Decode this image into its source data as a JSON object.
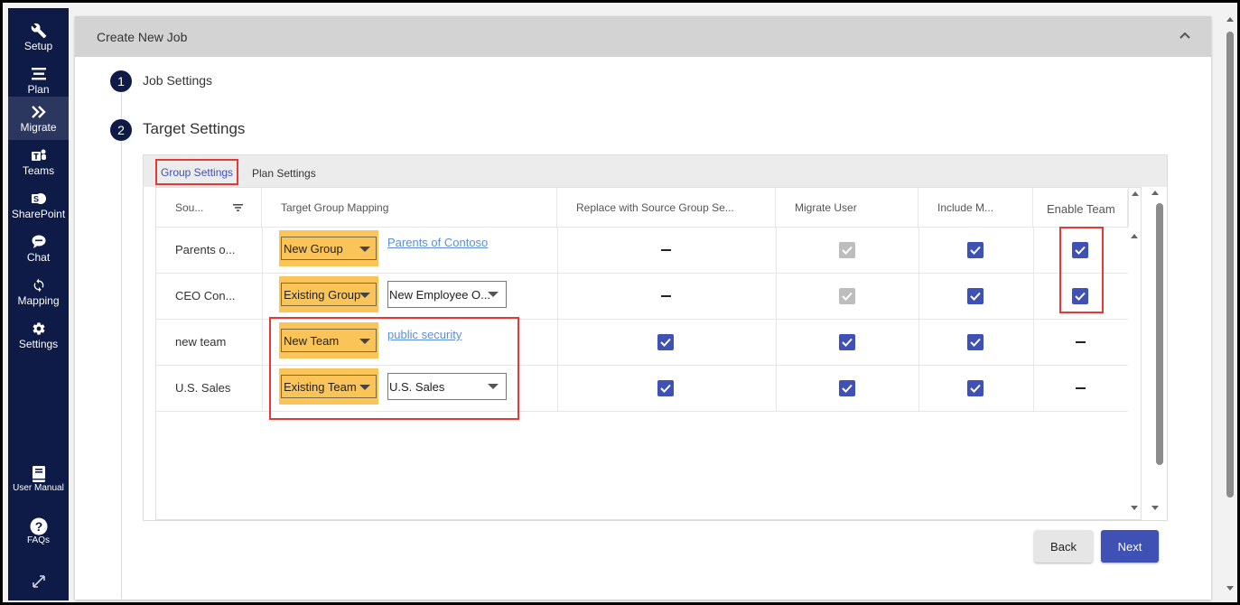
{
  "sidebar": {
    "items": [
      {
        "label": "Setup",
        "icon": "wrench-icon"
      },
      {
        "label": "Plan",
        "icon": "list-icon"
      },
      {
        "label": "Migrate",
        "icon": "double-chevron-icon"
      },
      {
        "label": "Teams",
        "icon": "teams-icon"
      },
      {
        "label": "SharePoint",
        "icon": "sharepoint-icon"
      },
      {
        "label": "Chat",
        "icon": "chat-bubble-icon"
      },
      {
        "label": "Mapping",
        "icon": "sync-icon"
      },
      {
        "label": "Settings",
        "icon": "gear-icon"
      }
    ],
    "bottom": [
      {
        "label": "User Manual",
        "icon": "book-icon"
      },
      {
        "label": "FAQs",
        "icon": "help-circle-icon"
      }
    ],
    "active": "Migrate"
  },
  "header": {
    "title": "Create New Job"
  },
  "steps": [
    {
      "number": "1",
      "title": "Job Settings"
    },
    {
      "number": "2",
      "title": "Target Settings"
    }
  ],
  "tabs": [
    {
      "label": "Group Settings",
      "active": true
    },
    {
      "label": "Plan Settings",
      "active": false
    }
  ],
  "table": {
    "columns": [
      "Sou...",
      "Target Group Mapping",
      "Replace with Source Group Se...",
      "Migrate User",
      "Include M...",
      "Enable Team"
    ],
    "rows": [
      {
        "source": "Parents o...",
        "type": "New Group",
        "target": "Parents of Contoso",
        "target_kind": "link",
        "replace": "dash",
        "migrate_user": "disabled-checked",
        "include": "checked",
        "enable_team": "checked"
      },
      {
        "source": "CEO Con...",
        "type": "Existing Group",
        "target": "New Employee O...",
        "target_kind": "select",
        "replace": "dash",
        "migrate_user": "disabled-checked",
        "include": "checked",
        "enable_team": "checked"
      },
      {
        "source": "new team",
        "type": "New Team",
        "target": "public security",
        "target_kind": "link",
        "replace": "checked",
        "migrate_user": "checked",
        "include": "checked",
        "enable_team": "dash"
      },
      {
        "source": "U.S. Sales",
        "type": "Existing Team",
        "target": "U.S. Sales",
        "target_kind": "select",
        "replace": "checked",
        "migrate_user": "checked",
        "include": "checked",
        "enable_team": "dash"
      }
    ]
  },
  "buttons": {
    "back": "Back",
    "next": "Next"
  },
  "colors": {
    "sidebar": "#0d1b46",
    "accent": "#3f51b5",
    "select_highlight": "#fbc458",
    "annotation": "#e53935"
  }
}
